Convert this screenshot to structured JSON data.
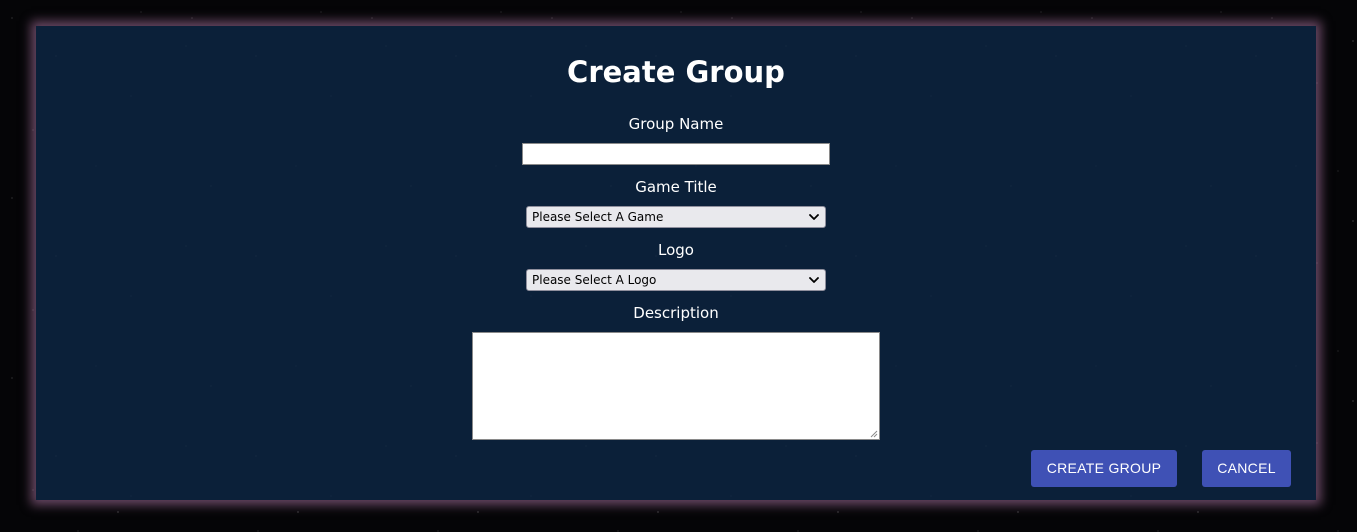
{
  "form": {
    "title": "Create Group",
    "group_name": {
      "label": "Group Name",
      "value": ""
    },
    "game_title": {
      "label": "Game Title",
      "selected": "Please Select A Game"
    },
    "logo": {
      "label": "Logo",
      "selected": "Please Select A Logo"
    },
    "description": {
      "label": "Description",
      "value": ""
    }
  },
  "actions": {
    "create_label": "CREATE GROUP",
    "cancel_label": "CANCEL"
  },
  "colors": {
    "panel_background": "#0b2039",
    "button_primary": "#3f51b5",
    "panel_glow": "#b97daf",
    "page_background": "#050507"
  },
  "icons": {
    "select_arrow": "chevron-down-icon",
    "textarea_grip": "resize-grip-icon"
  }
}
